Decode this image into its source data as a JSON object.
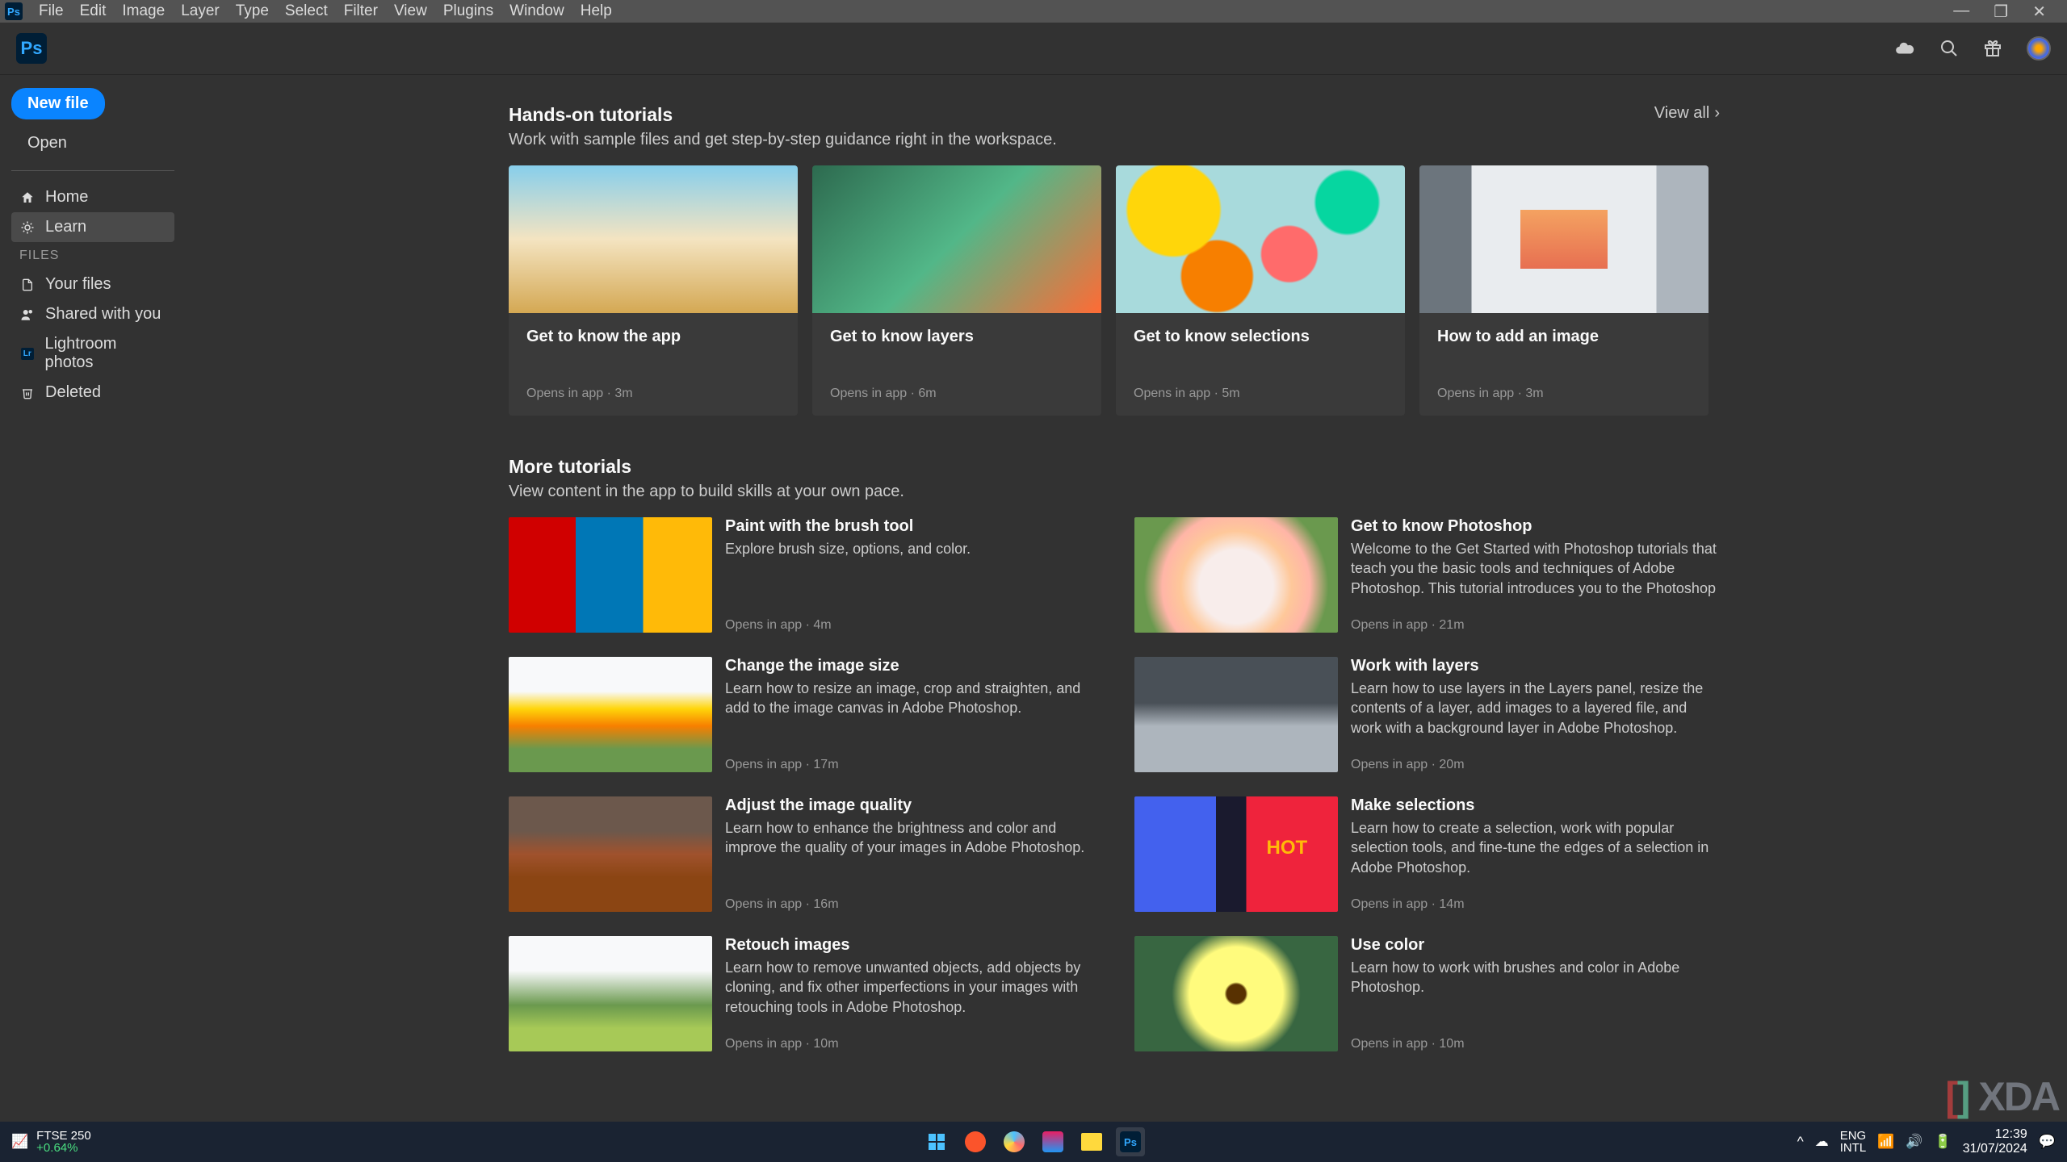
{
  "menubar": {
    "items": [
      "File",
      "Edit",
      "Image",
      "Layer",
      "Type",
      "Select",
      "Filter",
      "View",
      "Plugins",
      "Window",
      "Help"
    ]
  },
  "sidebar": {
    "new_file": "New file",
    "open": "Open",
    "nav": [
      {
        "icon": "home",
        "label": "Home"
      },
      {
        "icon": "learn",
        "label": "Learn"
      }
    ],
    "files_heading": "FILES",
    "files": [
      {
        "icon": "file",
        "label": "Your files"
      },
      {
        "icon": "shared",
        "label": "Shared with you"
      },
      {
        "icon": "lr",
        "label": "Lightroom photos"
      },
      {
        "icon": "trash",
        "label": "Deleted"
      }
    ]
  },
  "hands_on": {
    "title": "Hands-on tutorials",
    "subtitle": "Work with sample files and get step-by-step guidance right in the workspace.",
    "view_all": "View all",
    "cards": [
      {
        "title": "Get to know the app",
        "meta": "Opens in app  ·  3m"
      },
      {
        "title": "Get to know layers",
        "meta": "Opens in app  ·  6m"
      },
      {
        "title": "Get to know selections",
        "meta": "Opens in app  ·  5m"
      },
      {
        "title": "How to add an image",
        "meta": "Opens in app  ·  3m"
      }
    ]
  },
  "more": {
    "title": "More tutorials",
    "subtitle": "View content in the app to build skills at your own pace.",
    "items": [
      {
        "title": "Paint with the brush tool",
        "desc": "Explore brush size, options, and color.",
        "meta": "Opens in app  ·  4m"
      },
      {
        "title": "Get to know Photoshop",
        "desc": "Welcome to the Get Started with Photoshop tutorials that teach you the basic tools and techniques of Adobe Photoshop. This tutorial introduces you to the Photoshop work area and shows you how to open and save …",
        "meta": "Opens in app  ·  21m"
      },
      {
        "title": "Change the image size",
        "desc": "Learn how to resize an image, crop and straighten, and add to the image canvas in Adobe Photoshop.",
        "meta": "Opens in app  ·  17m"
      },
      {
        "title": "Work with layers",
        "desc": "Learn how to use layers in the Layers panel, resize the contents of a layer, add images to a layered file, and work with a background layer in Adobe Photoshop.",
        "meta": "Opens in app  ·  20m"
      },
      {
        "title": "Adjust the image quality",
        "desc": "Learn how to enhance the brightness and color and improve the quality of your images in Adobe Photoshop.",
        "meta": "Opens in app  ·  16m"
      },
      {
        "title": "Make selections",
        "desc": "Learn how to create a selection, work with popular selection tools, and fine-tune the edges of a selection in Adobe Photoshop.",
        "meta": "Opens in app  ·  14m"
      },
      {
        "title": "Retouch images",
        "desc": "Learn how to remove unwanted objects, add objects by cloning, and fix other imperfections in your images with retouching tools in Adobe Photoshop.",
        "meta": "Opens in app  ·  10m"
      },
      {
        "title": "Use color",
        "desc": "Learn how to work with brushes and color in Adobe Photoshop.",
        "meta": "Opens in app  ·  10m"
      }
    ]
  },
  "taskbar": {
    "stock_name": "FTSE 250",
    "stock_pct": "+0.64%",
    "lang1": "ENG",
    "lang2": "INTL",
    "time": "12:39",
    "date": "31/07/2024"
  },
  "watermark": "XDA"
}
